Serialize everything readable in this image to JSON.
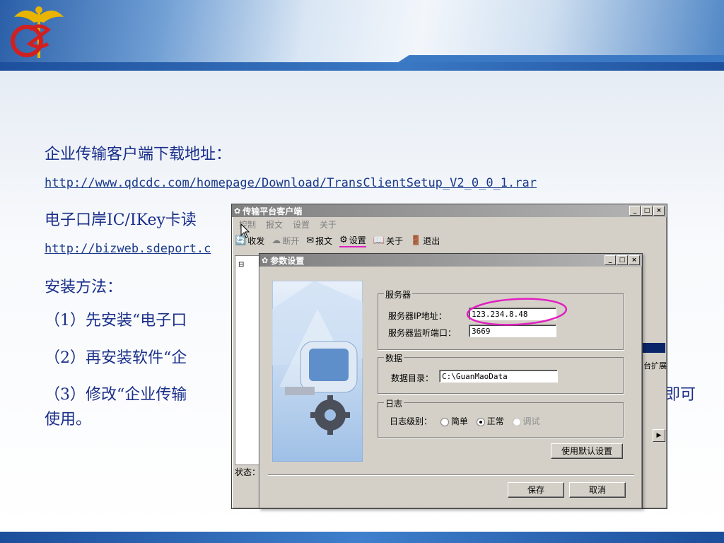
{
  "slide": {
    "heading1": "企业传输客户端下载地址：",
    "link1": "http://www.qdcdc.com/homepage/Download/TransClientSetup_V2_0_0_1.rar",
    "heading2": "电子口岸IC/IKey卡读",
    "link2": "http://bizweb.sdeport.c",
    "install_title": "安装方法：",
    "step1": "（1）先安装“电子口",
    "step2": "（2）再安装软件“企",
    "step3": "（3）修改“企业传输",
    "step3_tail": "即可",
    "step3_line2": "使用。"
  },
  "client_window": {
    "title": "传输平台客户端",
    "menu": [
      "控制",
      "报文",
      "设置",
      "关于"
    ],
    "toolbar": [
      {
        "label": "收发",
        "icon": "send-receive-icon"
      },
      {
        "label": "断开",
        "icon": "disconnect-icon"
      },
      {
        "label": "报文",
        "icon": "message-icon"
      },
      {
        "label": "设置",
        "icon": "settings-icon"
      },
      {
        "label": "关于",
        "icon": "about-icon"
      },
      {
        "label": "退出",
        "icon": "exit-icon"
      }
    ],
    "status_label": "状态：",
    "side_text": "台扩展"
  },
  "settings_dialog": {
    "title": "参数设置",
    "server_group": "服务器",
    "ip_label": "服务器IP地址：",
    "ip_value": "123.234.8.48",
    "port_label": "服务器监听端口：",
    "port_value": "3669",
    "data_group": "数据",
    "dir_label": "数据目录：",
    "dir_value": "C:\\GuanMaoData",
    "log_group": "日志",
    "log_label": "日志级别：",
    "log_options": [
      "简单",
      "正常",
      "调试"
    ],
    "log_selected": "正常",
    "default_button": "使用默认设置",
    "save_button": "保存",
    "cancel_button": "取消"
  },
  "colors": {
    "slide_text": "#1a2f8a",
    "highlight": "#e020c0",
    "title_inactive": "#808080"
  }
}
